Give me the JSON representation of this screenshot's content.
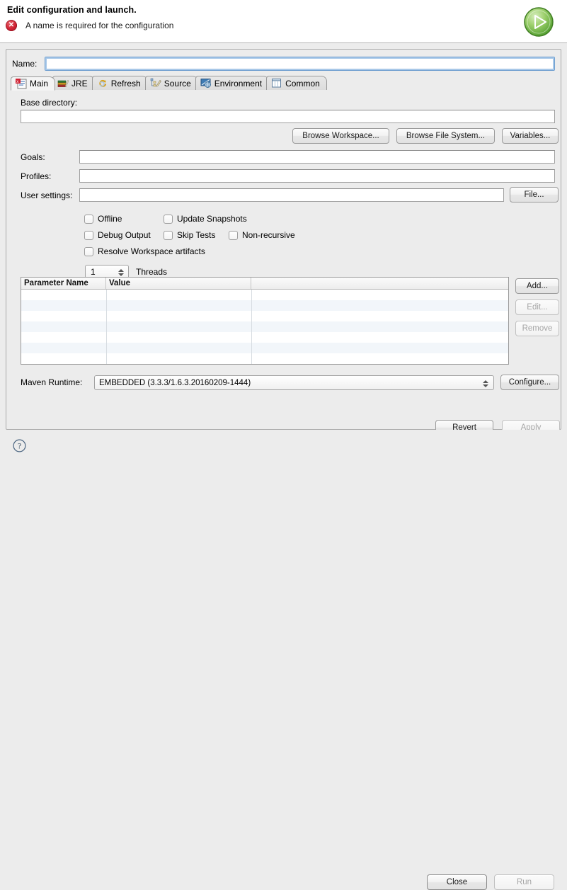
{
  "titlebar": {
    "title": "Edit configuration and launch.",
    "error_message": "A name is required for the configuration",
    "error_icon": "error-x-icon",
    "run_badge_icon": "run-play-icon",
    "error_color": "#cf2233",
    "run_color": "#6cb33f"
  },
  "name_field": {
    "label": "Name:",
    "value": "",
    "placeholder": ""
  },
  "tabs": [
    {
      "label": "Main",
      "icon": "main-tab-icon",
      "active": true
    },
    {
      "label": "JRE",
      "icon": "jre-tab-icon",
      "active": false
    },
    {
      "label": "Refresh",
      "icon": "refresh-tab-icon",
      "active": false
    },
    {
      "label": "Source",
      "icon": "source-tab-icon",
      "active": false
    },
    {
      "label": "Environment",
      "icon": "environment-tab-icon",
      "active": false
    },
    {
      "label": "Common",
      "icon": "common-tab-icon",
      "active": false
    }
  ],
  "main_tab": {
    "base_directory": {
      "label": "Base directory:",
      "value": "",
      "buttons": [
        "Browse Workspace...",
        "Browse File System...",
        "Variables..."
      ]
    },
    "goals": {
      "label": "Goals:",
      "value": ""
    },
    "profiles": {
      "label": "Profiles:",
      "value": ""
    },
    "user_settings": {
      "label": "User settings:",
      "value": "",
      "button": "File..."
    },
    "checkboxes": [
      {
        "label": "Offline",
        "checked": false
      },
      {
        "label": "Update Snapshots",
        "checked": false
      },
      {
        "label": "Debug Output",
        "checked": false
      },
      {
        "label": "Skip Tests",
        "checked": false
      },
      {
        "label": "Non-recursive",
        "checked": false
      },
      {
        "label": "Resolve Workspace artifacts",
        "checked": false
      }
    ],
    "threads": {
      "value": "1",
      "label": "Threads"
    },
    "parameter_table": {
      "columns": [
        "Parameter Name",
        "Value",
        ""
      ],
      "rows": [],
      "buttons": [
        {
          "label": "Add...",
          "enabled": true
        },
        {
          "label": "Edit...",
          "enabled": false
        },
        {
          "label": "Remove",
          "enabled": false
        }
      ]
    },
    "maven_runtime": {
      "label": "Maven Runtime:",
      "value": "EMBEDDED (3.3.3/1.6.3.20160209-1444)",
      "button": "Configure..."
    },
    "footer_buttons": [
      {
        "label": "Revert",
        "enabled": true
      },
      {
        "label": "Apply",
        "enabled": false
      }
    ]
  },
  "bottom_bar": {
    "help_icon": "help-question-icon",
    "buttons": [
      {
        "label": "Close",
        "enabled": true
      },
      {
        "label": "Run",
        "enabled": false
      }
    ]
  }
}
